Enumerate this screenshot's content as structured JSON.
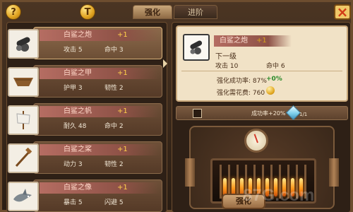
{
  "top_bar": {
    "help_label": "?",
    "currency_label": "T",
    "close_label": "×",
    "tabs": [
      {
        "label": "强化",
        "active": true
      },
      {
        "label": "进阶",
        "active": false
      }
    ]
  },
  "items": [
    {
      "name": "白鲨之炮",
      "plus": "+1",
      "stat1_label": "攻击",
      "stat1_value": "5",
      "stat2_label": "命中",
      "stat2_value": "3",
      "selected": true,
      "icon": "cannon-icon"
    },
    {
      "name": "白鲨之甲",
      "plus": "+1",
      "stat1_label": "护甲",
      "stat1_value": "3",
      "stat2_label": "韧性",
      "stat2_value": "2",
      "selected": false,
      "icon": "ship-hull-icon"
    },
    {
      "name": "白鲨之帆",
      "plus": "+1",
      "stat1_label": "耐久",
      "stat1_value": "48",
      "stat2_label": "命中",
      "stat2_value": "2",
      "selected": false,
      "icon": "sail-icon"
    },
    {
      "name": "白鲨之桨",
      "plus": "+1",
      "stat1_label": "动力",
      "stat1_value": "3",
      "stat2_label": "韧性",
      "stat2_value": "2",
      "selected": false,
      "icon": "oars-icon"
    },
    {
      "name": "白鲨之像",
      "plus": "+1",
      "stat1_label": "暴击",
      "stat1_value": "5",
      "stat2_label": "闪避",
      "stat2_value": "5",
      "selected": false,
      "icon": "shark-figurehead-icon"
    }
  ],
  "detail": {
    "name": "白鲨之炮",
    "plus": "+1",
    "next_level_label": "下一级",
    "stat1_label": "攻击",
    "stat1_value": "10",
    "stat2_label": "命中",
    "stat2_value": "6",
    "rate_label": "强化成功率",
    "rate_value": "87%",
    "rate_delta": "0%",
    "cost_label": "强化需花费",
    "cost_value": "760"
  },
  "slot": {
    "success_text": "成功率+20%",
    "gem_count": "1/1"
  },
  "furnace": {
    "button_label": "强化"
  },
  "watermark": "87G.com"
}
